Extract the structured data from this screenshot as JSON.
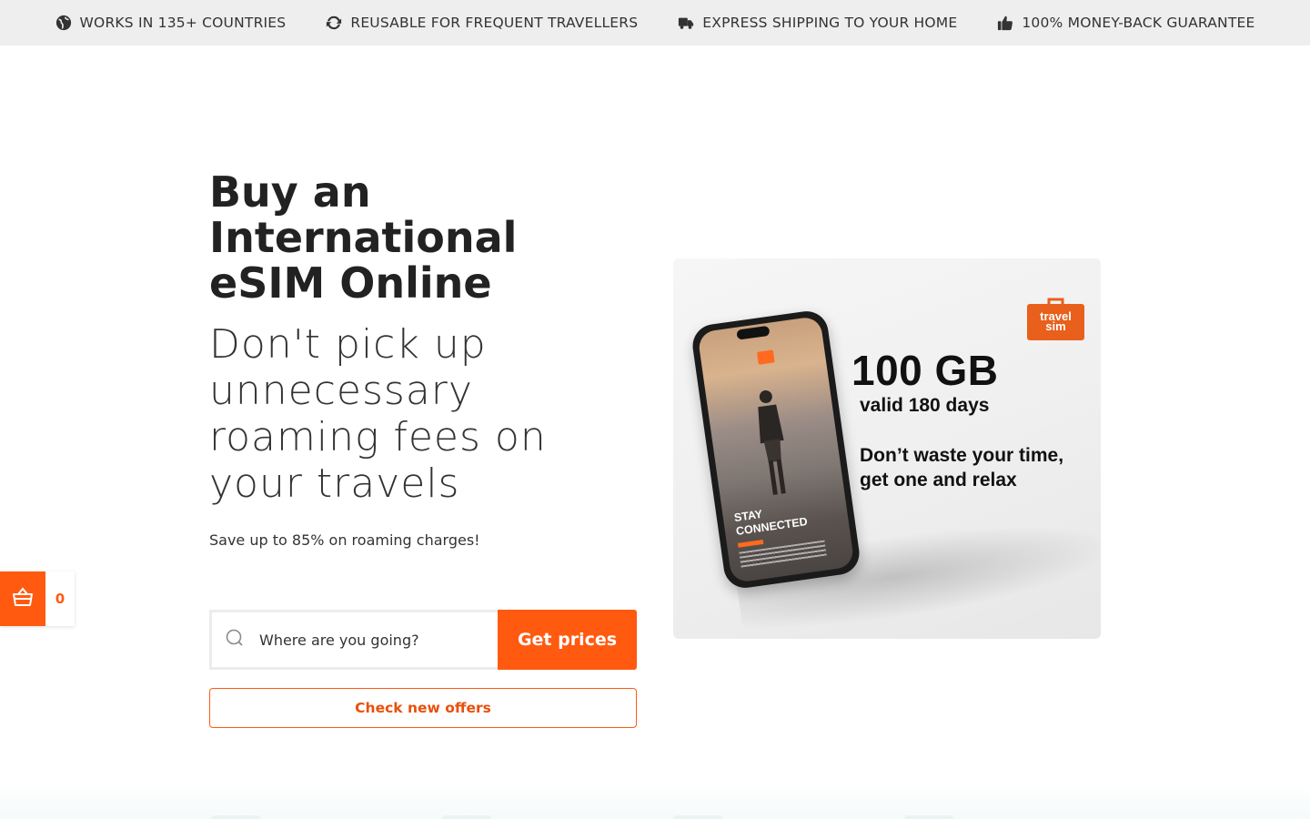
{
  "topbar": {
    "items": [
      {
        "icon": "globe-icon",
        "label": "WORKS IN 135+ COUNTRIES"
      },
      {
        "icon": "refresh-icon",
        "label": "REUSABLE FOR FREQUENT TRAVELLERS"
      },
      {
        "icon": "truck-icon",
        "label": "EXPRESS SHIPPING TO YOUR HOME"
      },
      {
        "icon": "thumbs-up-icon",
        "label": "100% MONEY-BACK GUARANTEE"
      }
    ]
  },
  "hero": {
    "title": "Buy an International eSIM Online",
    "subtitle": "Don't pick up unnecessary roaming fees on your travels",
    "save_text": "Save up to 85% on roaming charges!"
  },
  "search": {
    "placeholder": "Where are you going?",
    "button_label": "Get prices"
  },
  "offers": {
    "button_label": "Check new offers"
  },
  "cart": {
    "count": "0"
  },
  "product_card": {
    "brand_line1": "travel",
    "brand_line2": "sim",
    "data_amount": "100 GB",
    "validity": "valid 180 days",
    "tagline": "Don’t waste your time, get one and relax",
    "phone_caption_line1": "STAY",
    "phone_caption_line2": "CONNECTED"
  },
  "colors": {
    "accent": "#ff5a10",
    "topbar_bg": "#eeeeee",
    "text": "#222222"
  }
}
